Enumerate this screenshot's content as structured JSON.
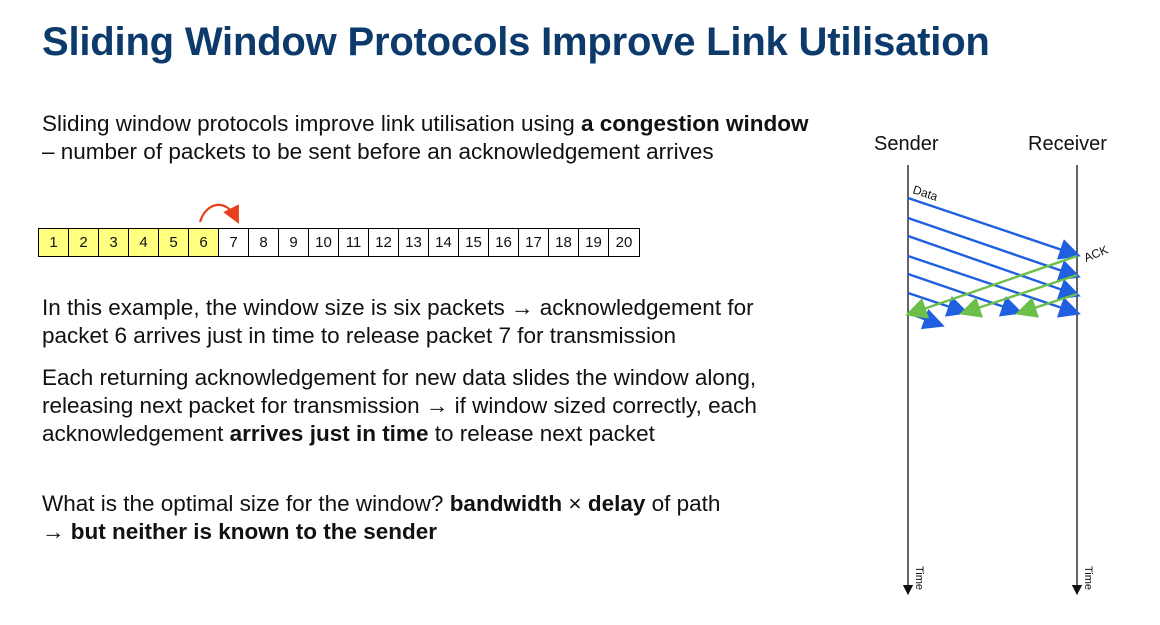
{
  "slide": {
    "title": "Sliding Window Protocols Improve Link Utilisation",
    "p1": {
      "a": "Sliding window protocols improve link utilisation using ",
      "b": "a congestion window",
      "c": " – number of packets to be sent before an acknowledgement arrives"
    },
    "p2": {
      "a": "In this example, the window size is six packets → acknowledgement for packet 6 arrives just in time to release packet 7 for transmission"
    },
    "p3": {
      "a": "Each returning acknowledgement for new data slides the window along, releasing next packet for transmission → if window sized correctly, each acknowledgement ",
      "b": "arrives just in time",
      "c": " to release next packet"
    },
    "p4": {
      "a": "What is the optimal size for the window? ",
      "b": "bandwidth",
      "c": " × ",
      "d": "delay",
      "e": " of path",
      "f": "→ but neither is known to the sender"
    }
  },
  "packets": [
    "1",
    "2",
    "3",
    "4",
    "5",
    "6",
    "7",
    "8",
    "9",
    "10",
    "11",
    "12",
    "13",
    "14",
    "15",
    "16",
    "17",
    "18",
    "19",
    "20"
  ],
  "window_size": 6,
  "diagram": {
    "sender_label": "Sender",
    "receiver_label": "Receiver",
    "data_label": "Data",
    "ack_label": "ACK",
    "time_label_sender": "Time",
    "time_label_receiver": "Time"
  },
  "colors": {
    "title": "#0b3a6b",
    "window_fill": "#ffff80",
    "data_arrow": "#1f5fe0",
    "ack_arrow": "#6cc04a",
    "slide_arrow": "#e8401c"
  }
}
